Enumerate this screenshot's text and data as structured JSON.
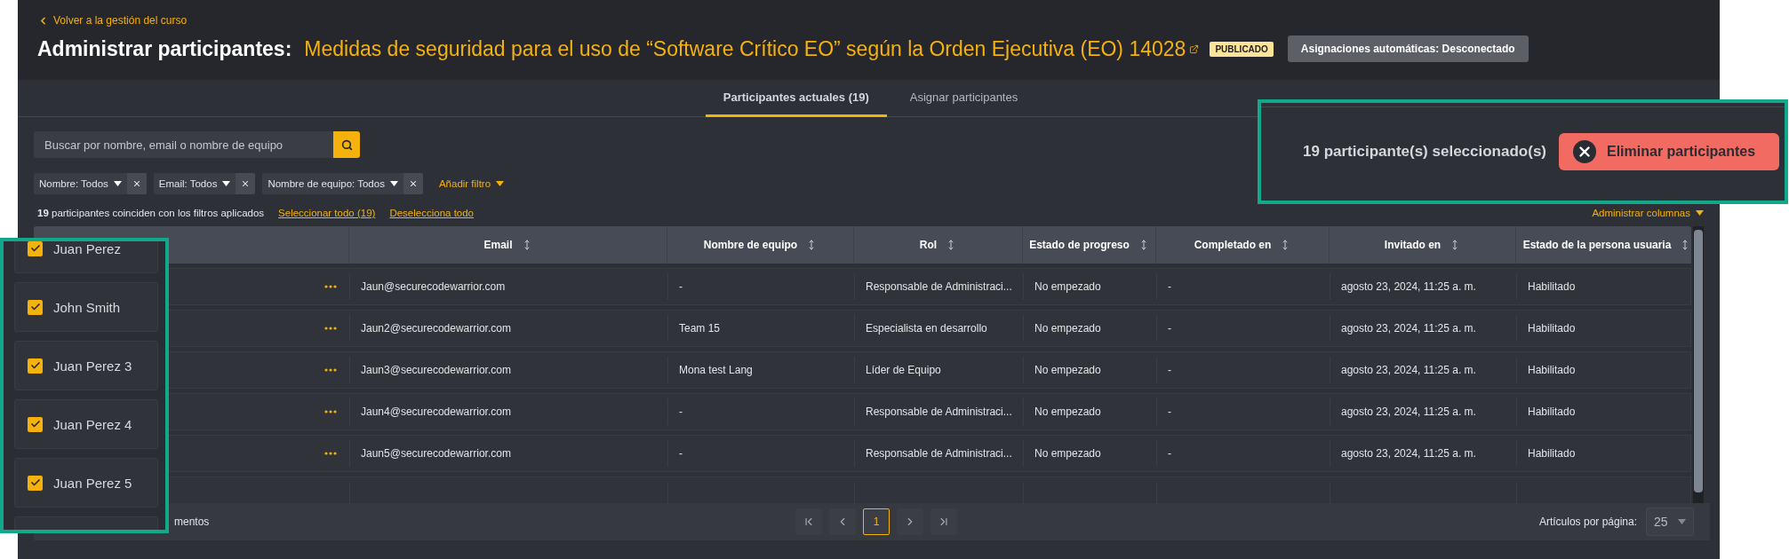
{
  "back_link": "Volver a la gestión del curso",
  "heading": {
    "label": "Administrar participantes:",
    "course": "Medidas de seguridad para el uso de “Software Crítico EO” según la Orden Ejecutiva (EO) 14028",
    "status_badge": "PUBLICADO",
    "auto_assign_button": "Asignaciones automáticas: Desconectado"
  },
  "tabs": [
    {
      "label": "Participantes actuales (19)",
      "selected": true
    },
    {
      "label": "Asignar participantes",
      "selected": false
    }
  ],
  "search": {
    "placeholder": "Buscar por nombre, email o nombre de equipo"
  },
  "filters": [
    {
      "label": "Nombre: Todos"
    },
    {
      "label": "Email: Todos"
    },
    {
      "label": "Nombre de equipo: Todos"
    }
  ],
  "add_filter": "Añadir filtro",
  "match_summary": "**19** participantes coinciden con los filtros aplicados",
  "select_all": "Seleccionar todo (19)",
  "deselect_all": "Deselecciona todo",
  "manage_columns": "Administrar columnas",
  "table": {
    "columns": [
      "Email",
      "Nombre de equipo",
      "Rol",
      "Estado de progreso",
      "Completado en",
      "Invitado en",
      "Estado de la persona usuaria"
    ],
    "rows": [
      {
        "email": "Jaun@securecodewarrior.com",
        "team": "-",
        "role": "Responsable de Administraci...",
        "progress": "No empezado",
        "completed": "-",
        "invited": "agosto 23, 2024, 11:25 a. m.",
        "user_status": "Habilitado"
      },
      {
        "email": "Jaun2@securecodewarrior.com",
        "team": "Team 15",
        "role": "Especialista en desarrollo",
        "progress": "No empezado",
        "completed": "-",
        "invited": "agosto 23, 2024, 11:25 a. m.",
        "user_status": "Habilitado"
      },
      {
        "email": "Jaun3@securecodewarrior.com",
        "team": "Mona test Lang",
        "role": "Líder de Equipo",
        "progress": "No empezado",
        "completed": "-",
        "invited": "agosto 23, 2024, 11:25 a. m.",
        "user_status": "Habilitado"
      },
      {
        "email": "Jaun4@securecodewarrior.com",
        "team": "-",
        "role": "Responsable de Administraci...",
        "progress": "No empezado",
        "completed": "-",
        "invited": "agosto 23, 2024, 11:25 a. m.",
        "user_status": "Habilitado"
      },
      {
        "email": "Jaun5@securecodewarrior.com",
        "team": "-",
        "role": "Responsable de Administraci...",
        "progress": "No empezado",
        "completed": "-",
        "invited": "agosto 23, 2024, 11:25 a. m.",
        "user_status": "Habilitado"
      }
    ]
  },
  "footer": {
    "count_text": "mentos",
    "pages": [
      {
        "label": "1",
        "selected": true
      }
    ],
    "per_page_label": "Artículos por página:",
    "per_page": "25"
  },
  "selection_callout": {
    "text": "19 participante(s) seleccionado(s)",
    "remove_button": "Eliminar participantes"
  },
  "checkbox_callout": {
    "items": [
      {
        "name": "Juan Perez",
        "checked": true
      },
      {
        "name": "John Smith",
        "checked": true
      },
      {
        "name": "Juan Perez 3",
        "checked": true
      },
      {
        "name": "Juan Perez 4",
        "checked": true
      },
      {
        "name": "Juan Perez 5",
        "checked": true
      }
    ]
  }
}
